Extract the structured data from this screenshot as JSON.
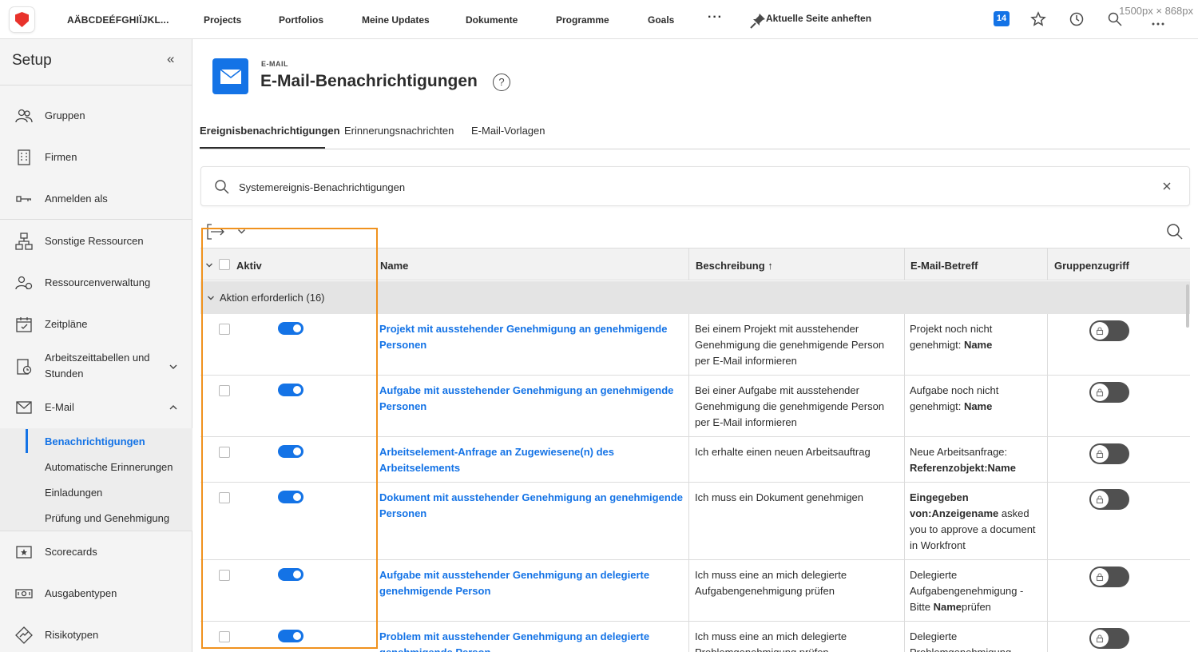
{
  "topnav": {
    "org": "AÄBCDEÉFGHIÏJKL...",
    "items": [
      "Projects",
      "Portfolios",
      "Meine Updates",
      "Dokumente",
      "Programme",
      "Goals"
    ],
    "more": "···",
    "pin_label": "Aktuelle Seite anheften",
    "badge": "14",
    "dims": "1500px × 868px"
  },
  "sidebar": {
    "title": "Setup",
    "collapse": "«",
    "items": [
      {
        "label": "Gruppen",
        "icon": "groups-icon"
      },
      {
        "label": "Firmen",
        "icon": "building-icon"
      },
      {
        "label": "Anmelden als",
        "icon": "key-icon"
      },
      {
        "label": "Sonstige Ressourcen",
        "icon": "hierarchy-icon"
      },
      {
        "label": "Ressourcenverwaltung",
        "icon": "resource-users-icon"
      },
      {
        "label": "Zeitpläne",
        "icon": "calendar-icon"
      },
      {
        "label": "Arbeitszeittabellen und Stunden",
        "icon": "timesheet-icon"
      },
      {
        "label": "E-Mail",
        "icon": "mail-icon"
      },
      {
        "label": "Scorecards",
        "icon": "scorecard-icon"
      },
      {
        "label": "Ausgabentypen",
        "icon": "money-icon"
      },
      {
        "label": "Risikotypen",
        "icon": "risk-icon"
      }
    ],
    "email_sub": [
      "Benachrichtigungen",
      "Automatische Erinnerungen",
      "Einladungen",
      "Prüfung und Genehmigung"
    ]
  },
  "header": {
    "kicker": "E-MAIL",
    "title": "E-Mail-Benachrichtigungen",
    "help": "?"
  },
  "tabs": [
    "Ereignisbenachrichtigungen",
    "Erinnerungsnachrichten",
    "E-Mail-Vorlagen"
  ],
  "search": {
    "value": "Systemereignis-Benachrichtigungen"
  },
  "table": {
    "columns": [
      "Aktiv",
      "Name",
      "Beschreibung ↑",
      "E-Mail-Betreff",
      "Gruppenzugriff"
    ],
    "group": "Aktion erforderlich (16)",
    "rows": [
      {
        "name": "Projekt mit ausstehender Genehmigung an genehmigende Personen",
        "description": "Bei einem Projekt mit ausstehender Genehmigung die genehmigende Person per E-Mail informieren",
        "subject_parts": [
          {
            "t": "Projekt noch nicht genehmigt: ",
            "b": false
          },
          {
            "t": "Name",
            "b": true
          }
        ],
        "active": true
      },
      {
        "name": "Aufgabe mit ausstehender Genehmigung an genehmigende Personen",
        "description": "Bei einer Aufgabe mit ausstehender Genehmigung die genehmigende Person per E-Mail informieren",
        "subject_parts": [
          {
            "t": "Aufgabe noch nicht genehmigt: ",
            "b": false
          },
          {
            "t": "Name",
            "b": true
          }
        ],
        "active": true
      },
      {
        "name": "Arbeitselement-Anfrage an Zugewiesene(n) des Arbeitselements",
        "description": "Ich erhalte einen neuen Arbeitsauftrag",
        "subject_parts": [
          {
            "t": "Neue Arbeitsanfrage: ",
            "b": false
          },
          {
            "t": "Referenzobjekt:Name",
            "b": true
          }
        ],
        "active": true
      },
      {
        "name": "Dokument mit ausstehender Genehmigung an genehmigende Personen",
        "description": "Ich muss ein Dokument genehmigen",
        "subject_parts": [
          {
            "t": "Eingegeben von:Anzeigename",
            "b": true
          },
          {
            "t": " asked you to approve a document in Workfront",
            "b": false
          }
        ],
        "active": true
      },
      {
        "name": "Aufgabe mit ausstehender Genehmigung an delegierte genehmigende Person",
        "description": "Ich muss eine an mich delegierte Aufgabengenehmigung prüfen",
        "subject_parts": [
          {
            "t": "Delegierte Aufgabengenehmigung - Bitte ",
            "b": false
          },
          {
            "t": "Name",
            "b": true
          },
          {
            "t": "prüfen",
            "b": false
          }
        ],
        "active": true
      },
      {
        "name": "Problem mit ausstehender Genehmigung an delegierte genehmigende Person",
        "description": "Ich muss eine an mich delegierte Problemgenehmigung prüfen",
        "subject_parts": [
          {
            "t": "Delegierte Problemgenehmigung",
            "b": false
          }
        ],
        "active": true
      }
    ]
  },
  "colors": {
    "accent": "#1473e6",
    "highlight": "#f0921e",
    "brand": "#e8322b"
  }
}
